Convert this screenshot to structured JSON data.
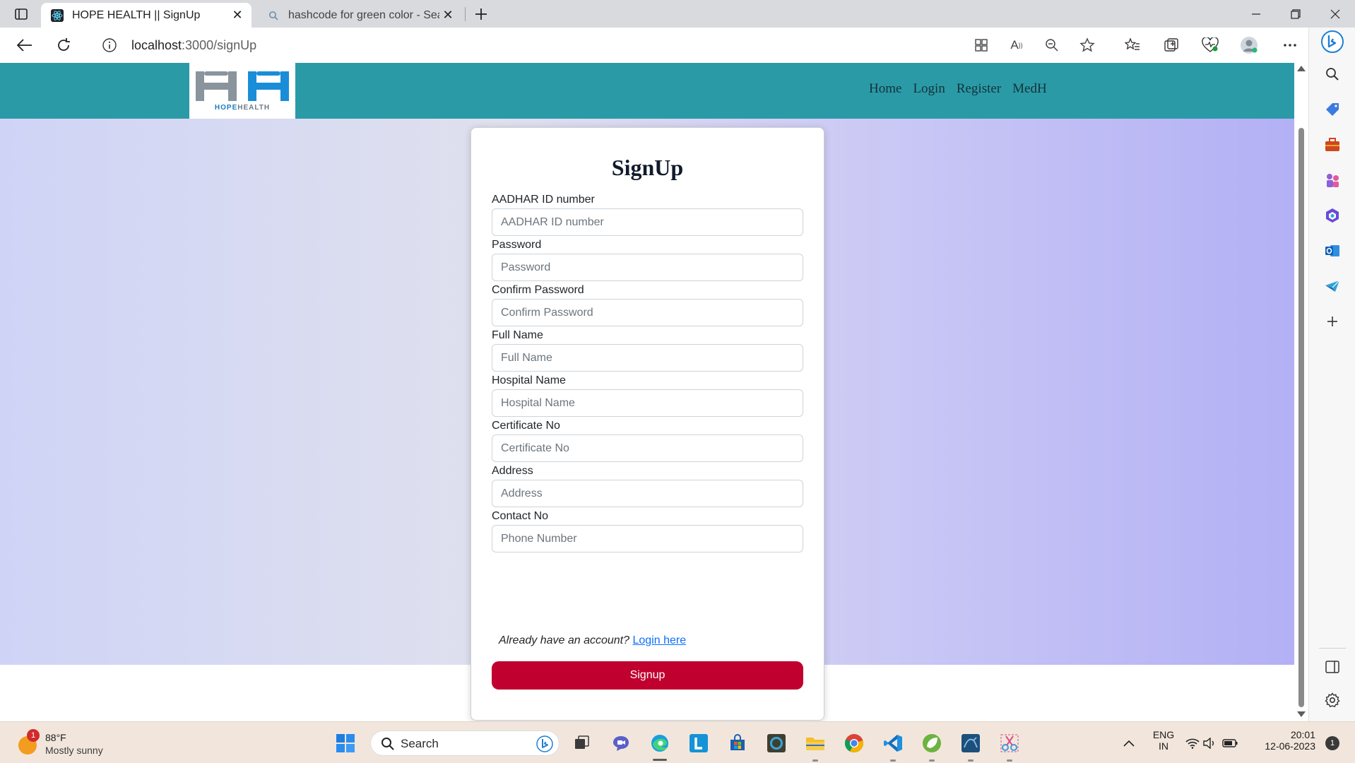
{
  "browser": {
    "tabs": [
      {
        "title": "HOPE HEALTH || SignUp",
        "active": true,
        "icon": "react-icon"
      },
      {
        "title": "hashcode for green color - Searc",
        "active": false,
        "icon": "search-icon"
      }
    ],
    "url_host": "localhost",
    "url_rest": ":3000/signUp"
  },
  "site": {
    "logo_text_a": "HOPE",
    "logo_text_b": "HEALTH",
    "nav": [
      "Home",
      "Login",
      "Register",
      "MedH"
    ]
  },
  "form": {
    "title": "SignUp",
    "fields": [
      {
        "label": "AADHAR ID number",
        "placeholder": "AADHAR ID number"
      },
      {
        "label": "Password",
        "placeholder": "Password"
      },
      {
        "label": "Confirm Password",
        "placeholder": "Confirm Password"
      },
      {
        "label": "Full Name",
        "placeholder": "Full Name"
      },
      {
        "label": "Hospital Name",
        "placeholder": "Hospital Name"
      },
      {
        "label": "Certificate No",
        "placeholder": "Certificate No"
      },
      {
        "label": "Address",
        "placeholder": "Address"
      },
      {
        "label": "Contact No",
        "placeholder": "Phone Number"
      }
    ],
    "account_prompt": "Already have an account?",
    "login_link": "Login here",
    "submit_label": "Signup",
    "submit_color": "#c0002e"
  },
  "theme": {
    "header_color": "#2b9aa7"
  },
  "taskbar": {
    "weather_temp": "88°F",
    "weather_condition": "Mostly sunny",
    "weather_badge": "1",
    "search_label": "Search",
    "lang_1": "ENG",
    "lang_2": "IN",
    "time": "20:01",
    "date": "12-06-2023",
    "notifications": "1"
  }
}
